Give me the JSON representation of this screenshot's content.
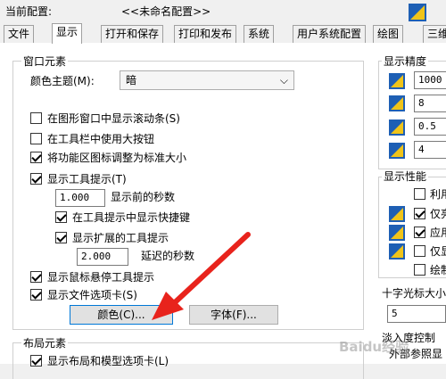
{
  "header": {
    "current_config_label": "当前配置:",
    "current_config_value": "<<未命名配置>>"
  },
  "tabs": [
    {
      "label": "文件"
    },
    {
      "label": "显示",
      "active": true
    },
    {
      "label": "打开和保存"
    },
    {
      "label": "打印和发布"
    },
    {
      "label": "系统"
    },
    {
      "label": "用户系统配置"
    },
    {
      "label": "绘图"
    },
    {
      "label": "三维"
    }
  ],
  "window_elements": {
    "title": "窗口元素",
    "color_theme_label": "颜色主题(M):",
    "color_theme_value": "暗",
    "checks": [
      {
        "label": "在图形窗口中显示滚动条(S)",
        "checked": false
      },
      {
        "label": "在工具栏中使用大按钮",
        "checked": false
      },
      {
        "label": "将功能区图标调整为标准大小",
        "checked": true
      },
      {
        "label": "显示工具提示(T)",
        "checked": true
      }
    ],
    "delay_before_value": "1.000",
    "delay_before_label": "显示前的秒数",
    "show_shortcut_label": "在工具提示中显示快捷键",
    "show_shortcut_checked": true,
    "show_extended_label": "显示扩展的工具提示",
    "show_extended_checked": true,
    "extended_delay_value": "2.000",
    "extended_delay_label": "延迟的秒数",
    "hover_tooltip_label": "显示鼠标悬停工具提示",
    "hover_tooltip_checked": true,
    "file_tabs_label": "显示文件选项卡(S)",
    "file_tabs_checked": true,
    "colors_button": "颜色(C)...",
    "fonts_button": "字体(F)..."
  },
  "layout_elements": {
    "title": "布局元素",
    "first_check_label": "显示布局和模型选项卡(L)",
    "first_check_checked": true
  },
  "display_resolution": {
    "title": "显示精度",
    "values": [
      "1000",
      "8",
      "0.5",
      "4"
    ]
  },
  "display_performance": {
    "title": "显示性能",
    "items": [
      {
        "label": "利用",
        "checked": false
      },
      {
        "label": "仅亮",
        "checked": true
      },
      {
        "label": "应用",
        "checked": true
      },
      {
        "label": "仅显",
        "checked": false
      },
      {
        "label": "绘制",
        "checked": false
      }
    ]
  },
  "crosshair": {
    "title": "十字光标大小",
    "value": "5"
  },
  "fade_control": {
    "title": "淡入度控制",
    "xref_label": "外部参照显"
  },
  "watermark": "Baidu经验",
  "colors": {
    "accent": "#0078d7",
    "arrow": "#e8231c",
    "icon_blue": "#1e5fb4",
    "icon_yellow": "#f0c419"
  }
}
